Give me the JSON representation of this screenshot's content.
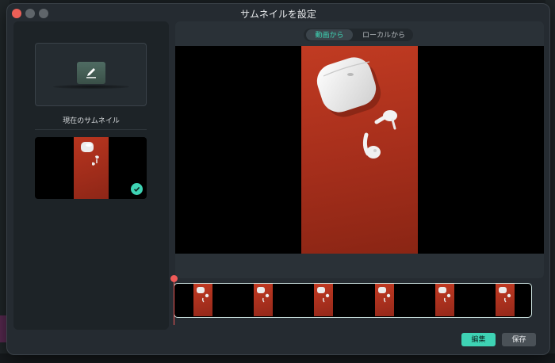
{
  "window": {
    "title": "サムネイルを設定"
  },
  "left_panel": {
    "current_thumbnail_label": "現在のサムネイル"
  },
  "right_panel": {
    "source_tabs": [
      {
        "label": "動画から",
        "selected": true
      },
      {
        "label": "ローカルから",
        "selected": false
      }
    ]
  },
  "timeline": {
    "frame_count": 6
  },
  "footer": {
    "edit_label": "編集",
    "save_label": "保存"
  },
  "colors": {
    "accent": "#3ed3b4",
    "playhead": "#ef5a58",
    "close": "#ed5f57"
  },
  "icons": {
    "placeholder": "pencil-edit-icon",
    "selected_check": "check-circle-icon"
  }
}
